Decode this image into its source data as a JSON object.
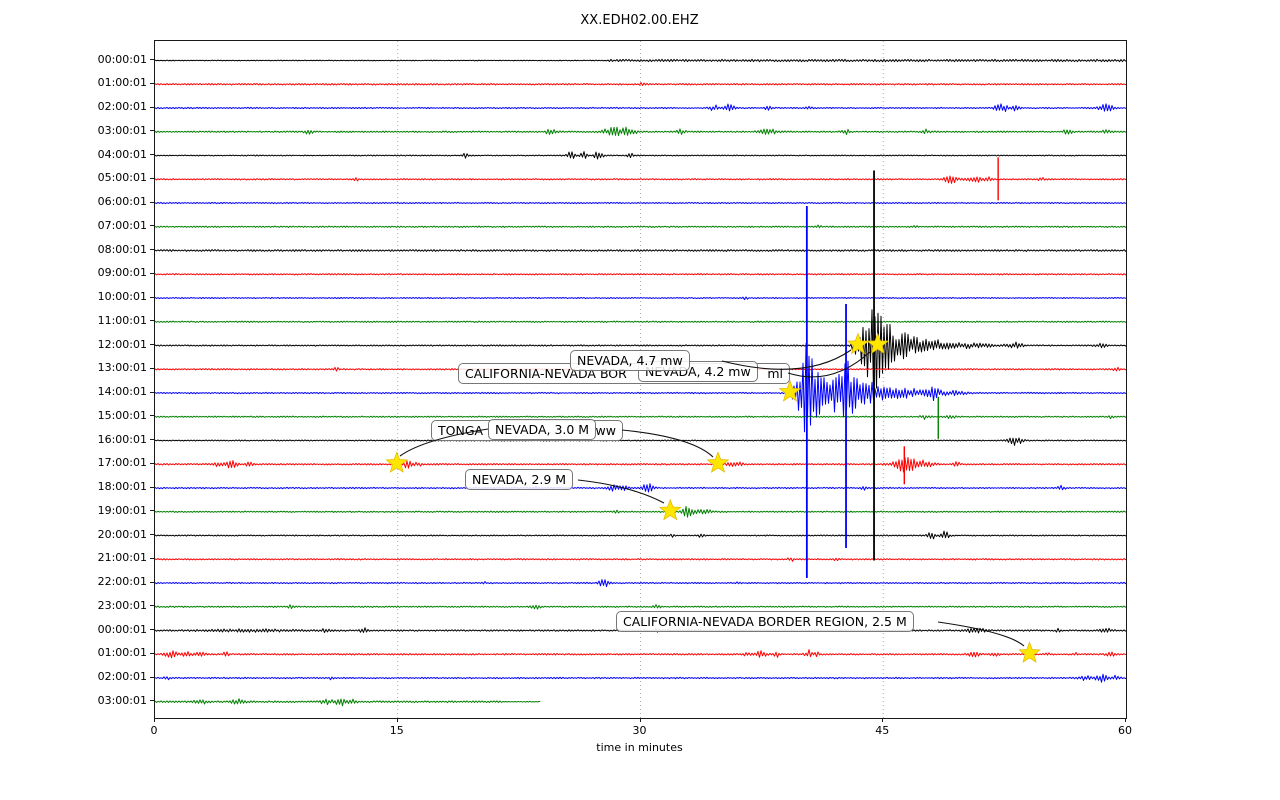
{
  "title": "XX.EDH02.00.EHZ",
  "axes": {
    "xlabel": "time in minutes",
    "x_ticks": [
      "0",
      "15",
      "30",
      "45",
      "60"
    ],
    "y_ticks": [
      "00:00:01",
      "01:00:01",
      "02:00:01",
      "03:00:01",
      "04:00:01",
      "05:00:01",
      "06:00:01",
      "07:00:01",
      "08:00:01",
      "09:00:01",
      "10:00:01",
      "11:00:01",
      "12:00:01",
      "13:00:01",
      "14:00:01",
      "15:00:01",
      "16:00:01",
      "17:00:01",
      "18:00:01",
      "19:00:01",
      "20:00:01",
      "21:00:01",
      "22:00:01",
      "23:00:01",
      "00:00:01",
      "01:00:01",
      "02:00:01",
      "03:00:01"
    ]
  },
  "annotations": [
    {
      "id": "nevada_47",
      "text": "NEVADA, 4.7 mw"
    },
    {
      "id": "cal_nev_border_ml",
      "prefix": "CALIFORNIA-NEVADA BOR",
      "suffix": "ml"
    },
    {
      "id": "nevada_42",
      "text": "NEVADA, 4.2 mw"
    },
    {
      "id": "tonga",
      "prefix": "TONGA",
      "suffix": "ww"
    },
    {
      "id": "nevada_30",
      "text": "NEVADA, 3.0 M"
    },
    {
      "id": "nevada_29",
      "text": "NEVADA, 2.9 M"
    },
    {
      "id": "cal_nev_border_25",
      "text": "CALIFORNIA-NEVADA BORDER REGION, 2.5 M"
    }
  ],
  "chart_data": {
    "type": "line",
    "title": "XX.EDH02.00.EHZ",
    "xlabel": "time in minutes",
    "xlim": [
      0,
      60
    ],
    "x_ticks": [
      0,
      15,
      30,
      45,
      60
    ],
    "grid": {
      "x_minutes": [
        15,
        30,
        45
      ],
      "style": "dotted"
    },
    "row_colors_cycle": [
      "black",
      "red",
      "blue",
      "green"
    ],
    "star_color": "#ffe600",
    "stars": [
      {
        "row": 12,
        "minute": 43.5
      },
      {
        "row": 12,
        "minute": 44.72
      },
      {
        "row": 14,
        "minute": 39.3
      },
      {
        "row": 17,
        "minute": 15.0
      },
      {
        "row": 17,
        "minute": 34.85
      },
      {
        "row": 19,
        "minute": 31.9
      },
      {
        "row": 25,
        "minute": 54.1
      }
    ],
    "rows": [
      {
        "label": "00:00:01",
        "color": "black",
        "noise": [
          [
            0,
            27.9,
            0.4
          ],
          [
            27.9,
            60,
            1.2
          ]
        ],
        "events": [],
        "spikes": []
      },
      {
        "label": "01:00:01",
        "color": "red",
        "noise": [
          [
            0,
            60,
            0.8
          ]
        ],
        "events": [
          [
            30.1,
            0.1,
            1.5
          ]
        ],
        "spikes": []
      },
      {
        "label": "02:00:01",
        "color": "blue",
        "noise": [
          [
            0,
            60,
            0.7
          ]
        ],
        "events": [
          [
            34.6,
            0.25,
            2.5
          ],
          [
            35.5,
            0.18,
            5
          ],
          [
            37.9,
            0.15,
            2
          ],
          [
            40.4,
            0.12,
            2.2
          ],
          [
            52.3,
            0.3,
            4.5
          ],
          [
            53.2,
            0.2,
            2.5
          ],
          [
            58.8,
            0.35,
            3.5
          ]
        ],
        "spikes": []
      },
      {
        "label": "03:00:01",
        "color": "green",
        "noise": [
          [
            0,
            60,
            0.8
          ]
        ],
        "events": [
          [
            9.5,
            0.2,
            2
          ],
          [
            24.5,
            0.25,
            2.5
          ],
          [
            28.4,
            0.5,
            4
          ],
          [
            29.3,
            0.3,
            3
          ],
          [
            32.5,
            0.2,
            2.2
          ],
          [
            37.9,
            0.4,
            2.5
          ],
          [
            42.7,
            0.2,
            2
          ],
          [
            47.6,
            0.2,
            2
          ],
          [
            56.4,
            0.2,
            2.2
          ],
          [
            58.8,
            0.2,
            2
          ]
        ],
        "spikes": []
      },
      {
        "label": "04:00:01",
        "color": "black",
        "noise": [
          [
            0,
            60,
            0.55
          ]
        ],
        "events": [
          [
            19.2,
            0.15,
            2.5
          ],
          [
            25.7,
            0.18,
            4.5
          ],
          [
            26.5,
            0.15,
            3.5
          ],
          [
            27.4,
            0.18,
            4.5
          ],
          [
            29.4,
            0.15,
            2
          ]
        ],
        "spikes": []
      },
      {
        "label": "05:00:01",
        "color": "red",
        "noise": [
          [
            0,
            60,
            0.7
          ]
        ],
        "events": [
          [
            12.4,
            0.1,
            2
          ],
          [
            49.2,
            0.3,
            3.5
          ],
          [
            50.6,
            0.3,
            3.5
          ],
          [
            51.5,
            0.2,
            2
          ],
          [
            54.8,
            0.15,
            1.5
          ]
        ],
        "spikes": [
          [
            52.1,
            22,
            21
          ]
        ]
      },
      {
        "label": "06:00:01",
        "color": "blue",
        "noise": [
          [
            0,
            60,
            0.65
          ]
        ],
        "events": [],
        "spikes": []
      },
      {
        "label": "07:00:01",
        "color": "green",
        "noise": [
          [
            0,
            60,
            0.7
          ]
        ],
        "events": [
          [
            41,
            0.15,
            1.2
          ],
          [
            47,
            0.15,
            1.2
          ]
        ],
        "spikes": []
      },
      {
        "label": "08:00:01",
        "color": "black",
        "noise": [
          [
            0,
            60,
            0.95
          ]
        ],
        "events": [],
        "spikes": []
      },
      {
        "label": "09:00:01",
        "color": "red",
        "noise": [
          [
            0,
            60,
            0.7
          ]
        ],
        "events": [],
        "spikes": []
      },
      {
        "label": "10:00:01",
        "color": "blue",
        "noise": [
          [
            0,
            60,
            0.6
          ]
        ],
        "events": [
          [
            36.5,
            0.1,
            1.5
          ]
        ],
        "spikes": []
      },
      {
        "label": "11:00:01",
        "color": "green",
        "noise": [
          [
            0,
            60,
            0.7
          ]
        ],
        "events": [],
        "spikes": []
      },
      {
        "label": "12:00:01",
        "color": "black",
        "noise": [
          [
            0,
            60,
            0.7
          ]
        ],
        "events": [
          [
            43.3,
            0.2,
            6
          ],
          [
            43.9,
            0.3,
            26
          ],
          [
            44.4,
            0.25,
            35
          ],
          [
            45.0,
            0.4,
            22
          ],
          [
            45.9,
            0.7,
            10
          ],
          [
            47.3,
            1.1,
            5
          ],
          [
            49.4,
            1.8,
            2.5
          ],
          [
            53.2,
            0.3,
            2.5
          ],
          [
            58.4,
            0.25,
            2
          ]
        ],
        "spikes": [
          [
            44.43,
            175,
            215
          ]
        ]
      },
      {
        "label": "13:00:01",
        "color": "red",
        "noise": [
          [
            0,
            60,
            0.7
          ]
        ],
        "events": [
          [
            11.2,
            0.1,
            2
          ],
          [
            59.4,
            0.15,
            1.5
          ]
        ],
        "spikes": []
      },
      {
        "label": "14:00:01",
        "color": "blue",
        "noise": [
          [
            0,
            60,
            0.7
          ]
        ],
        "events": [
          [
            39.3,
            0.12,
            8
          ],
          [
            39.9,
            0.25,
            20
          ],
          [
            40.3,
            0.2,
            40
          ],
          [
            40.8,
            0.35,
            25
          ],
          [
            41.5,
            0.5,
            14
          ],
          [
            42.3,
            0.45,
            12
          ],
          [
            42.7,
            0.18,
            28
          ],
          [
            43.1,
            0.3,
            18
          ],
          [
            43.9,
            0.5,
            10
          ],
          [
            45.1,
            0.8,
            6
          ],
          [
            46.7,
            1.1,
            3.5
          ],
          [
            48.1,
            0.2,
            5
          ],
          [
            49.1,
            0.7,
            2
          ]
        ],
        "spikes": [
          [
            40.28,
            187,
            185
          ],
          [
            42.7,
            89,
            155
          ]
        ]
      },
      {
        "label": "15:00:01",
        "color": "green",
        "noise": [
          [
            0,
            60,
            0.7
          ]
        ],
        "events": [
          [
            47.6,
            0.2,
            2
          ],
          [
            49.2,
            0.2,
            2
          ],
          [
            59.1,
            0.15,
            1.5
          ]
        ],
        "spikes": [
          [
            48.4,
            20,
            22
          ]
        ]
      },
      {
        "label": "16:00:01",
        "color": "black",
        "noise": [
          [
            0,
            60,
            0.6
          ]
        ],
        "events": [
          [
            53.2,
            0.3,
            4.5
          ]
        ],
        "spikes": []
      },
      {
        "label": "17:00:01",
        "color": "red",
        "noise": [
          [
            0,
            60,
            0.8
          ]
        ],
        "events": [
          [
            3.8,
            0.2,
            2.5
          ],
          [
            4.7,
            0.25,
            3.5
          ],
          [
            5.8,
            0.2,
            2
          ],
          [
            15.6,
            0.15,
            4
          ],
          [
            16.2,
            0.2,
            1.8
          ],
          [
            35.5,
            0.15,
            4
          ],
          [
            36.1,
            0.2,
            1.8
          ],
          [
            46.3,
            0.45,
            7
          ],
          [
            47.3,
            0.5,
            4
          ],
          [
            49.5,
            0.15,
            3
          ]
        ],
        "spikes": [
          [
            46.3,
            18,
            20
          ]
        ]
      },
      {
        "label": "18:00:01",
        "color": "blue",
        "noise": [
          [
            0,
            60,
            0.7
          ]
        ],
        "events": [
          [
            23.5,
            0.2,
            1.5
          ],
          [
            28.3,
            0.2,
            3
          ],
          [
            28.9,
            0.18,
            4
          ],
          [
            30.5,
            0.22,
            6
          ],
          [
            43.8,
            0.1,
            2
          ],
          [
            56.0,
            0.15,
            2
          ]
        ],
        "spikes": []
      },
      {
        "label": "19:00:01",
        "color": "green",
        "noise": [
          [
            0,
            60,
            0.7
          ]
        ],
        "events": [
          [
            28.5,
            0.1,
            1.5
          ],
          [
            32.9,
            0.2,
            6
          ],
          [
            33.8,
            0.5,
            2
          ]
        ],
        "spikes": []
      },
      {
        "label": "20:00:01",
        "color": "black",
        "noise": [
          [
            0,
            60,
            0.6
          ]
        ],
        "events": [
          [
            32.0,
            0.1,
            1.5
          ],
          [
            33.7,
            0.15,
            1.5
          ],
          [
            48.0,
            0.18,
            4
          ],
          [
            48.8,
            0.18,
            4
          ]
        ],
        "spikes": []
      },
      {
        "label": "21:00:01",
        "color": "red",
        "noise": [
          [
            0,
            60,
            0.7
          ]
        ],
        "events": [
          [
            39.3,
            0.12,
            2
          ],
          [
            42.1,
            0.1,
            1.5
          ]
        ],
        "spikes": []
      },
      {
        "label": "22:00:01",
        "color": "blue",
        "noise": [
          [
            0,
            60,
            0.7
          ]
        ],
        "events": [
          [
            20.3,
            0.1,
            1.5
          ],
          [
            27.7,
            0.2,
            5
          ],
          [
            36.0,
            0.1,
            1
          ]
        ],
        "spikes": []
      },
      {
        "label": "23:00:01",
        "color": "green",
        "noise": [
          [
            0,
            60,
            0.7
          ]
        ],
        "events": [
          [
            8.4,
            0.15,
            2
          ],
          [
            23.5,
            0.2,
            2.5
          ],
          [
            31.0,
            0.15,
            2
          ]
        ],
        "spikes": []
      },
      {
        "label": "00:00:01",
        "color": "black",
        "noise": [
          [
            0,
            60,
            0.8
          ]
        ],
        "events": [
          [
            6,
            2.2,
            1
          ],
          [
            10.6,
            0.2,
            2
          ],
          [
            12.9,
            0.15,
            2.5
          ],
          [
            31.0,
            0.1,
            1.5
          ],
          [
            50.7,
            0.5,
            2
          ],
          [
            55.8,
            0.1,
            1.5
          ],
          [
            58.8,
            0.25,
            2
          ]
        ],
        "spikes": []
      },
      {
        "label": "01:00:01",
        "color": "red",
        "noise": [
          [
            0,
            60,
            0.8
          ]
        ],
        "events": [
          [
            1.0,
            0.3,
            3
          ],
          [
            1.9,
            0.25,
            2.5
          ],
          [
            2.8,
            0.2,
            2
          ],
          [
            4.4,
            0.15,
            2
          ],
          [
            36.5,
            0.15,
            2
          ],
          [
            37.4,
            0.25,
            3
          ],
          [
            38.4,
            0.15,
            2.5
          ],
          [
            40.4,
            0.15,
            4
          ],
          [
            40.9,
            0.12,
            2
          ],
          [
            50.6,
            0.25,
            2.5
          ],
          [
            51.9,
            0.15,
            2
          ],
          [
            55.2,
            0.1,
            1.5
          ],
          [
            56.9,
            0.1,
            1.5
          ],
          [
            59.1,
            0.25,
            2
          ]
        ],
        "spikes": []
      },
      {
        "label": "02:00:01",
        "color": "blue",
        "noise": [
          [
            0,
            60,
            0.7
          ]
        ],
        "events": [
          [
            0.7,
            0.12,
            2
          ],
          [
            10.9,
            0.1,
            1.5
          ],
          [
            57.5,
            0.25,
            2.5
          ],
          [
            58.5,
            0.25,
            4
          ],
          [
            59.4,
            0.15,
            3
          ]
        ],
        "spikes": []
      },
      {
        "label": "03:00:01",
        "color": "green",
        "noise": [
          [
            0,
            21.5,
            0.9
          ],
          [
            21.5,
            23.8,
            0.4
          ]
        ],
        "events": [
          [
            2.8,
            0.25,
            2.5
          ],
          [
            5.1,
            0.25,
            2.5
          ],
          [
            10.6,
            0.25,
            2.5
          ],
          [
            11.5,
            0.25,
            3.5
          ],
          [
            12.2,
            0.15,
            2
          ]
        ],
        "spikes": [],
        "end_min": 23.8
      }
    ]
  }
}
